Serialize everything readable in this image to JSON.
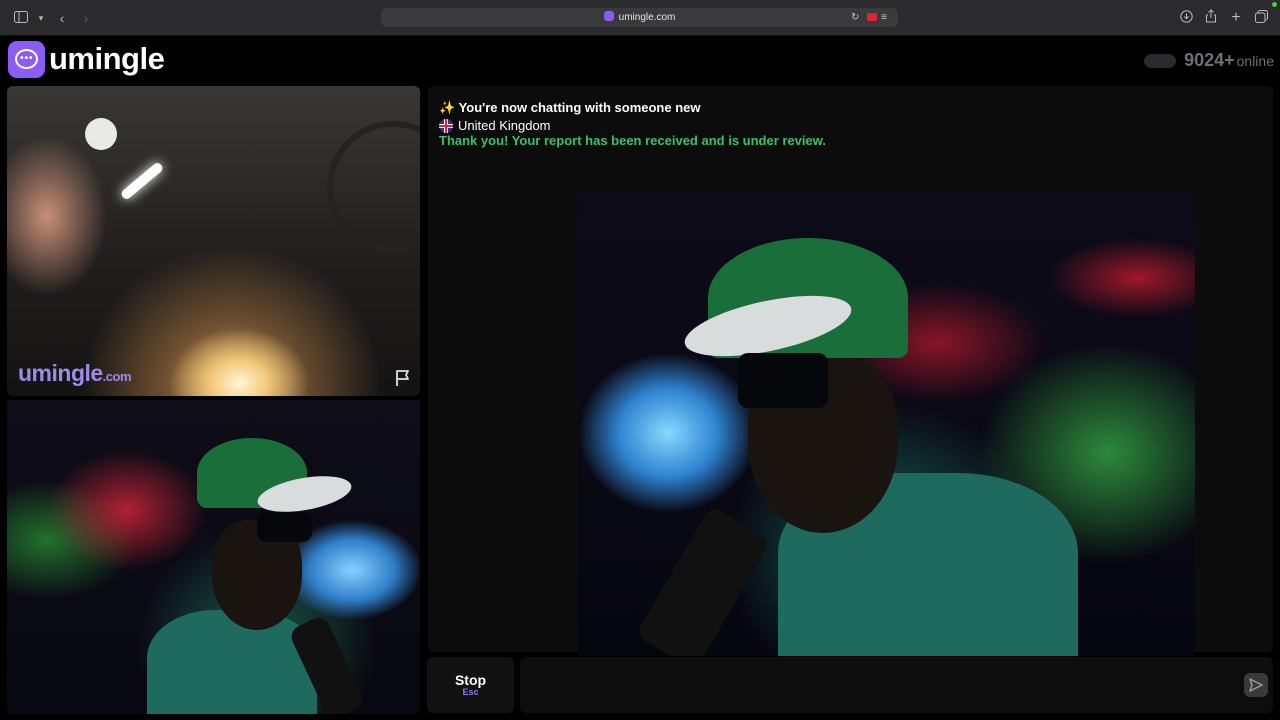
{
  "browser": {
    "url": "umingle.com",
    "icons": [
      "sidebar-icon",
      "chevron-down-icon",
      "back-icon",
      "forward-icon",
      "reload-icon",
      "camera-indicator-icon",
      "reader-icon",
      "download-icon",
      "share-icon",
      "new-tab-icon",
      "tabs-overview-icon"
    ]
  },
  "app": {
    "logo_text": "umingle",
    "brand_color": "#8b5cf6",
    "online_count": "9024+",
    "online_label": "online"
  },
  "self_video": {
    "watermark": "umingle",
    "watermark_domain": ".com",
    "report_icon": "flag-icon"
  },
  "chat": {
    "line1": "✨ You're now chatting with someone new",
    "country": "United Kingdom",
    "country_flag": "uk-flag-icon",
    "report_notice": "Thank you! Your report has been received and is under review.",
    "report_notice_color": "#39c06a"
  },
  "controls": {
    "stop_label": "Stop",
    "stop_shortcut": "Esc",
    "message_placeholder": "",
    "send_icon": "send-icon"
  }
}
